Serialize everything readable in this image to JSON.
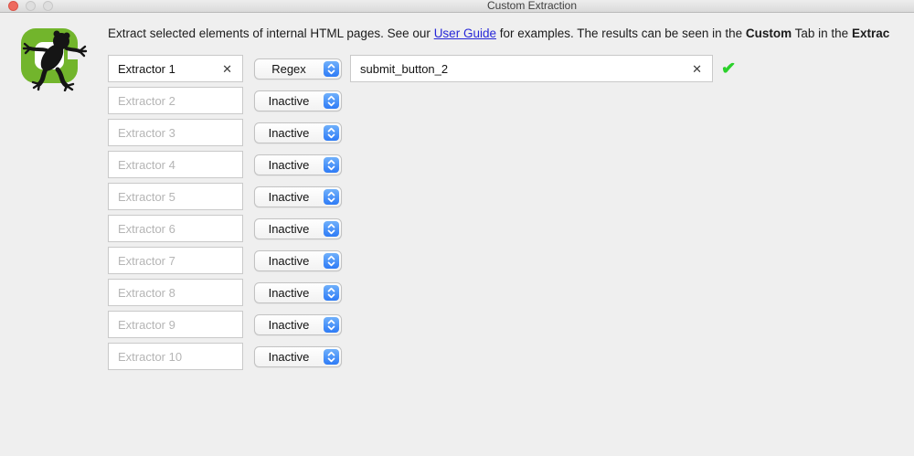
{
  "window": {
    "title": "Custom Extraction"
  },
  "description": {
    "part1": "Extract selected elements of internal HTML pages. See our ",
    "link_label": "User Guide",
    "part2": " for examples. The results can be seen in the ",
    "bold1": "Custom",
    "part3": " Tab in the ",
    "bold2": "Extrac"
  },
  "icons": {
    "clear": "✕",
    "check": "✔"
  },
  "extractors": [
    {
      "name": "Extractor 1",
      "mode": "Regex",
      "value": "submit_button_2",
      "status": "valid"
    },
    {
      "placeholder": "Extractor 2",
      "mode": "Inactive"
    },
    {
      "placeholder": "Extractor 3",
      "mode": "Inactive"
    },
    {
      "placeholder": "Extractor 4",
      "mode": "Inactive"
    },
    {
      "placeholder": "Extractor 5",
      "mode": "Inactive"
    },
    {
      "placeholder": "Extractor 6",
      "mode": "Inactive"
    },
    {
      "placeholder": "Extractor 7",
      "mode": "Inactive"
    },
    {
      "placeholder": "Extractor 8",
      "mode": "Inactive"
    },
    {
      "placeholder": "Extractor 9",
      "mode": "Inactive"
    },
    {
      "placeholder": "Extractor 10",
      "mode": "Inactive"
    }
  ],
  "colors": {
    "accent_blue": "#2e7bf6",
    "accent_blue_light": "#6fb0fb",
    "valid_green": "#2bd12b",
    "logo_green": "#72b52c",
    "link_blue": "#2626d8",
    "close_red": "#ee6a5e"
  }
}
